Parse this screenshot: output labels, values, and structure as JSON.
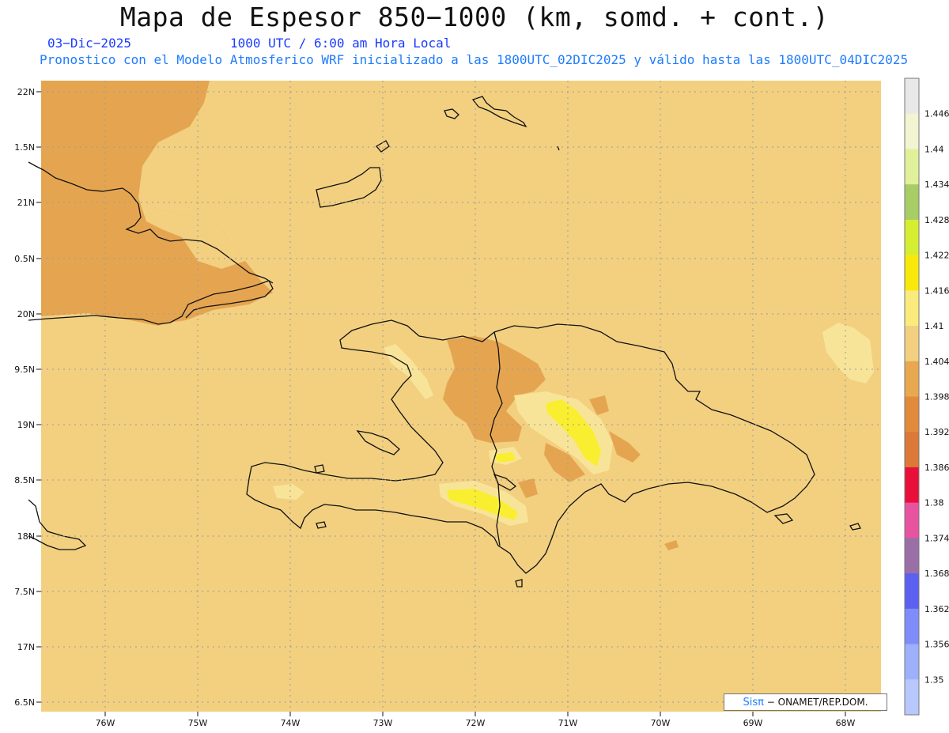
{
  "header": {
    "title": "Mapa de Espesor 850−1000 (km, somd. + cont.)",
    "date": "03−Dic−2025",
    "time": "1000 UTC / 6:00 am Hora Local",
    "model_line": "Pronostico con el Modelo Atmosferico WRF inicializado a las 1800UTC_02DIC2025 y válido hasta las  1800UTC_04DIC2025"
  },
  "map": {
    "lat_labels": [
      "22N",
      "1.5N",
      "21N",
      "0.5N",
      "20N",
      "9.5N",
      "19N",
      "8.5N",
      "18N",
      "7.5N",
      "17N",
      "6.5N"
    ],
    "lon_labels": [
      "76W",
      "75W",
      "74W",
      "73W",
      "72W",
      "71W",
      "70W",
      "69W",
      "68W"
    ],
    "colors": {
      "background": "#f2d080",
      "warm_dark": "#e5a550",
      "warm_darker": "#e09040",
      "light": "#f8e498",
      "yellow": "#f9ee30",
      "coast": "#111111"
    }
  },
  "colorbar": {
    "labels": [
      "1.446",
      "1.44",
      "1.434",
      "1.428",
      "1.422",
      "1.416",
      "1.41",
      "1.404",
      "1.398",
      "1.392",
      "1.386",
      "1.38",
      "1.374",
      "1.368",
      "1.362",
      "1.356",
      "1.35"
    ],
    "colors": [
      "#e8e8e8",
      "#f2f4d2",
      "#e1f09a",
      "#a6cd66",
      "#d6ee32",
      "#f9e90a",
      "#faeb7c",
      "#f2d080",
      "#e8a850",
      "#e28a3c",
      "#dc7838",
      "#e8103a",
      "#e853a0",
      "#9a6fa8",
      "#5c60f0",
      "#7f8cfa",
      "#9eb0fc",
      "#b8c8fc"
    ]
  },
  "credit": {
    "logo": "Sisπ",
    "text": "− ONAMET/REP.DOM."
  }
}
